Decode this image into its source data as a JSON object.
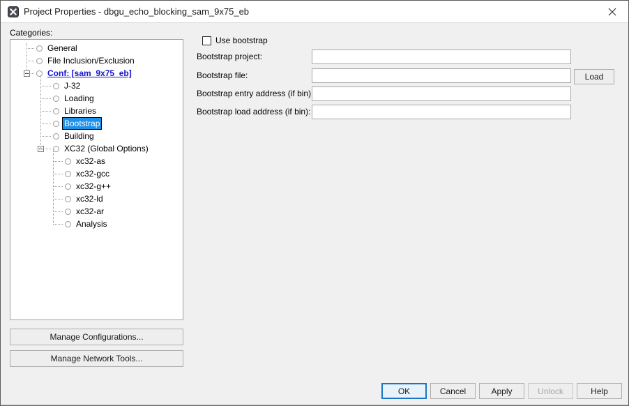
{
  "window": {
    "title": "Project Properties - dbgu_echo_blocking_sam_9x75_eb",
    "icon": "app-x-icon",
    "close_label": "close-icon"
  },
  "left": {
    "categories_label": "Categories:",
    "tree": [
      {
        "label": "General",
        "depth": 1,
        "type": "leaf",
        "selected": false,
        "style": "normal"
      },
      {
        "label": "File Inclusion/Exclusion",
        "depth": 1,
        "type": "leaf",
        "selected": false,
        "style": "normal"
      },
      {
        "label": "Conf: [sam_9x75_eb]",
        "depth": 1,
        "type": "parent",
        "selected": false,
        "style": "conf",
        "expanded": true
      },
      {
        "label": "J-32",
        "depth": 2,
        "type": "leaf",
        "selected": false,
        "style": "normal"
      },
      {
        "label": "Loading",
        "depth": 2,
        "type": "leaf",
        "selected": false,
        "style": "normal"
      },
      {
        "label": "Libraries",
        "depth": 2,
        "type": "leaf",
        "selected": false,
        "style": "normal"
      },
      {
        "label": "Bootstrap",
        "depth": 2,
        "type": "leaf",
        "selected": true,
        "style": "normal"
      },
      {
        "label": "Building",
        "depth": 2,
        "type": "leaf",
        "selected": false,
        "style": "normal"
      },
      {
        "label": "XC32 (Global Options)",
        "depth": 2,
        "type": "parent",
        "selected": false,
        "style": "normal",
        "expanded": true
      },
      {
        "label": "xc32-as",
        "depth": 3,
        "type": "leaf",
        "selected": false,
        "style": "normal"
      },
      {
        "label": "xc32-gcc",
        "depth": 3,
        "type": "leaf",
        "selected": false,
        "style": "normal"
      },
      {
        "label": "xc32-g++",
        "depth": 3,
        "type": "leaf",
        "selected": false,
        "style": "normal"
      },
      {
        "label": "xc32-ld",
        "depth": 3,
        "type": "leaf",
        "selected": false,
        "style": "normal"
      },
      {
        "label": "xc32-ar",
        "depth": 3,
        "type": "leaf",
        "selected": false,
        "style": "normal"
      },
      {
        "label": "Analysis",
        "depth": 3,
        "type": "leaf",
        "selected": false,
        "style": "normal"
      }
    ],
    "manage_configurations": "Manage Configurations...",
    "manage_network_tools": "Manage Network Tools..."
  },
  "form": {
    "use_bootstrap": {
      "label": "Use bootstrap",
      "checked": false
    },
    "fields": [
      {
        "label": "Bootstrap project:",
        "value": "",
        "placeholder": ""
      },
      {
        "label": "Bootstrap file:",
        "value": "",
        "placeholder": ""
      },
      {
        "label": "Bootstrap entry address (if bin):",
        "value": "",
        "placeholder": ""
      },
      {
        "label": "Bootstrap load address (if bin):",
        "value": "",
        "placeholder": ""
      }
    ],
    "load_button": "Load"
  },
  "footer": {
    "ok": "OK",
    "cancel": "Cancel",
    "apply": "Apply",
    "unlock": "Unlock",
    "help": "Help",
    "unlock_disabled": true
  },
  "colors": {
    "dialog_bg": "#f0f0f0",
    "titlebar_bg": "#ffffff",
    "selection_blue": "#1e90e8",
    "link_blue": "#1515cc",
    "default_button_border": "#1b74c4",
    "disabled_text": "#a6a6a6"
  }
}
